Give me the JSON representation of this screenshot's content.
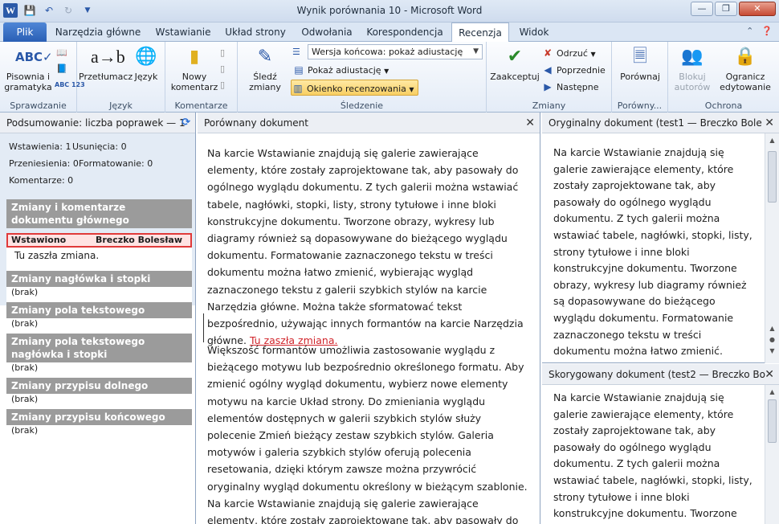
{
  "window": {
    "title": "Wynik porównania 10  -  Microsoft Word"
  },
  "tabs": [
    "Plik",
    "Narzędzia główne",
    "Wstawianie",
    "Układ strony",
    "Odwołania",
    "Korespondencja",
    "Recenzja",
    "Widok"
  ],
  "active_tab": "Recenzja",
  "ribbon": {
    "sprawdzanie": {
      "label": "Sprawdzanie",
      "spelling": "Pisownia i gramatyka"
    },
    "jezyk": {
      "label": "Język",
      "translate": "Przetłumacz",
      "language": "Język"
    },
    "komentarze": {
      "label": "Komentarze",
      "new_comment": "Nowy komentarz"
    },
    "sledzenie": {
      "label": "Śledzenie",
      "track": "Śledź zmiany",
      "display_combo": "Wersja końcowa: pokaż adiustację",
      "show_markup": "Pokaż adiustację",
      "review_pane": "Okienko recenzowania"
    },
    "zmiany": {
      "label": "Zmiany",
      "accept": "Zaakceptuj",
      "reject": "Odrzuć",
      "previous": "Poprzednie",
      "next": "Następne"
    },
    "porownywanie": {
      "label": "Porówny...",
      "compare": "Porównaj"
    },
    "ochrona": {
      "label": "Ochrona",
      "block_authors": "Blokuj autorów",
      "restrict": "Ogranicz edytowanie"
    }
  },
  "left": {
    "header": "Podsumowanie: liczba poprawek — 1",
    "insertions": "Wstawienia: 1",
    "deletions": "Usunięcia: 0",
    "moves": "Przeniesienia: 0",
    "formatting": "Formatowanie: 0",
    "comments": "Komentarze: 0",
    "cat_main": "Zmiany i komentarze dokumentu głównego",
    "change_type": "Wstawiono",
    "change_author": "Breczko Bolesław",
    "change_text": "Tu zaszła zmiana.",
    "cat_header": "Zmiany nagłówka i stopki",
    "cat_textbox": "Zmiany pola tekstowego",
    "cat_textbox_header": "Zmiany pola tekstowego nagłówka i stopki",
    "cat_footnote": "Zmiany przypisu dolnego",
    "cat_endnote": "Zmiany przypisu końcowego",
    "none": "(brak)"
  },
  "main": {
    "header": "Porównany dokument",
    "para1": "Na karcie Wstawianie znajdują się galerie zawierające elementy, które zostały zaprojektowane tak, aby pasowały do ogólnego wyglądu dokumentu.  Z tych galerii można wstawiać tabele, nagłówki, stopki, listy, strony tytułowe i inne bloki konstrukcyjne dokumentu.  Tworzone obrazy, wykresy lub diagramy również są dopasowywane do bieżącego wyglądu dokumentu. Formatowanie zaznaczonego tekstu w treści dokumentu można łatwo zmienić, wybierając wygląd zaznaczonego tekstu z galerii szybkich stylów na karcie Narzędzia główne. Można także sformatować tekst bezpośrednio, używając innych formantów na karcie Narzędzia główne.",
    "inserted": "Tu zaszła zmiana.",
    "para2": "Większość formantów umożliwia zastosowanie wyglądu z bieżącego motywu lub bezpośrednio określonego formatu.  Aby zmienić ogólny wygląd dokumentu, wybierz nowe elementy motywu na karcie Układ strony.  Do zmieniania wyglądu elementów dostępnych w galerii szybkich stylów służy polecenie Zmień bieżący zestaw szybkich stylów.  Galeria motywów i galeria szybkich stylów oferują polecenia resetowania, dzięki którym zawsze można przywrócić oryginalny wygląd dokumentu określony w bieżącym szablonie.  Na karcie Wstawianie znajdują się galerie zawierające elementy, które zostały zaprojektowane tak, aby pasowały do ogólnego wyglądu dokumentu."
  },
  "original": {
    "header": "Oryginalny dokument (test1 — Breczko Bole",
    "text": "Na karcie Wstawianie znajdują się galerie zawierające elementy, które zostały zaprojektowane tak, aby pasowały do ogólnego wyglądu dokumentu.  Z tych galerii można wstawiać tabele, nagłówki, stopki, listy, strony tytułowe i inne bloki konstrukcyjne dokumentu.  Tworzone obrazy, wykresy lub diagramy również są dopasowywane do bieżącego wyglądu dokumentu.  Formatowanie zaznaczonego tekstu w treści dokumentu można łatwo zmienić."
  },
  "revised": {
    "header": "Skorygowany dokument (test2 — Breczko Bo",
    "text": "Na karcie Wstawianie znajdują się galerie zawierające elementy, które zostały zaprojektowane tak, aby pasowały do ogólnego wyglądu dokumentu.  Z tych galerii można wstawiać tabele, nagłówki, stopki, listy, strony tytułowe i inne bloki konstrukcyjne dokumentu.  Tworzone"
  },
  "colors": {
    "accent": "#2a5fb5",
    "insert": "#d1242a",
    "category": "#9b9b9b",
    "highlight": "#f8cf63"
  }
}
